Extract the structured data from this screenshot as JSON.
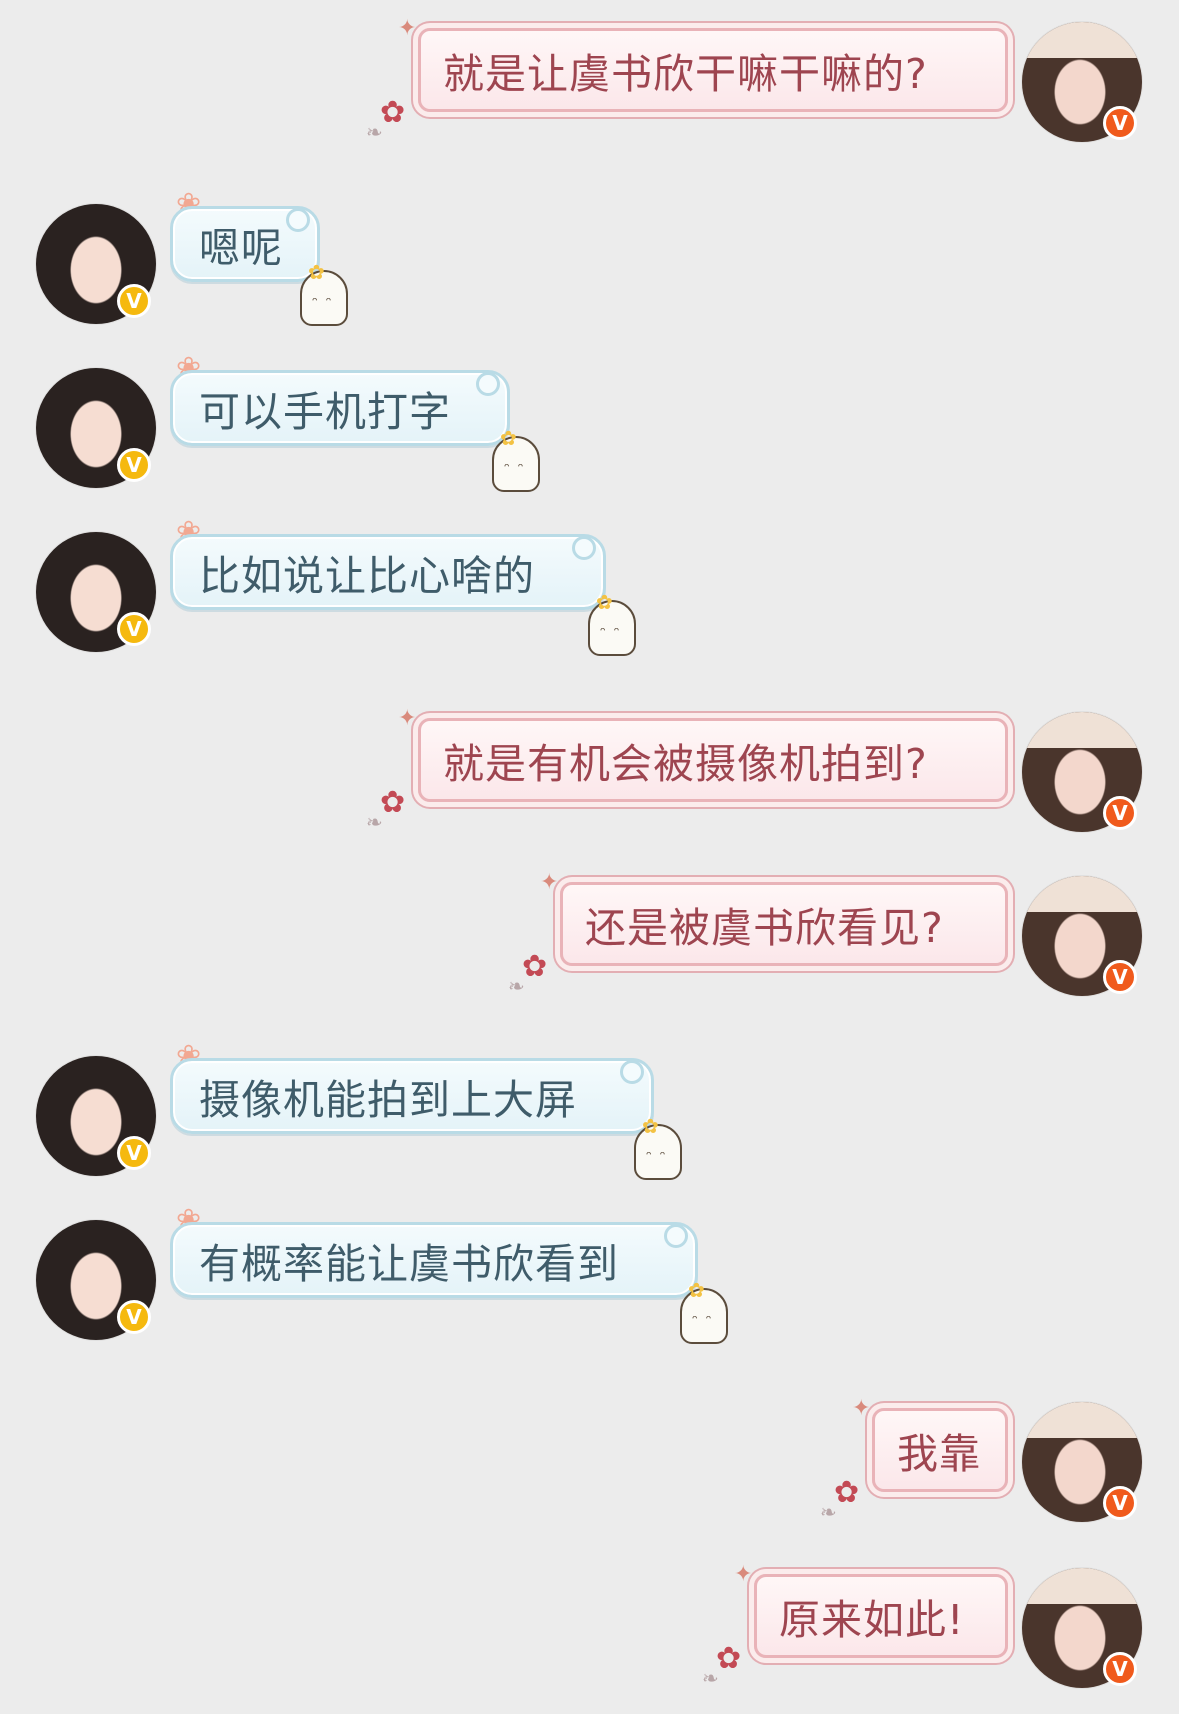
{
  "messages": [
    {
      "side": "right",
      "text": "就是让虞书欣干嘛干嘛的?",
      "badge": "V"
    },
    {
      "side": "left",
      "text": "嗯呢",
      "badge": "V"
    },
    {
      "side": "left",
      "text": "可以手机打字",
      "badge": "V"
    },
    {
      "side": "left",
      "text": "比如说让比心啥的",
      "badge": "V"
    },
    {
      "side": "right",
      "text": "就是有机会被摄像机拍到?",
      "badge": "V"
    },
    {
      "side": "right",
      "text": "还是被虞书欣看见?",
      "badge": "V"
    },
    {
      "side": "left",
      "text": "摄像机能拍到上大屏",
      "badge": "V"
    },
    {
      "side": "left",
      "text": "有概率能让虞书欣看到",
      "badge": "V"
    },
    {
      "side": "right",
      "text": "我靠",
      "badge": "V"
    },
    {
      "side": "right",
      "text": "原来如此!",
      "badge": "V"
    }
  ],
  "colors": {
    "background": "#ececec",
    "left_bubble_text": "#3f5c6a",
    "right_bubble_text": "#9e4550",
    "left_badge": "#f5b90f",
    "right_badge": "#f05a1c"
  },
  "icons": {
    "verified_badge": "verified-v-icon",
    "left_decoration": "flower-icon",
    "left_sticker": "ghost-icon",
    "right_decoration": "rose-icon"
  }
}
